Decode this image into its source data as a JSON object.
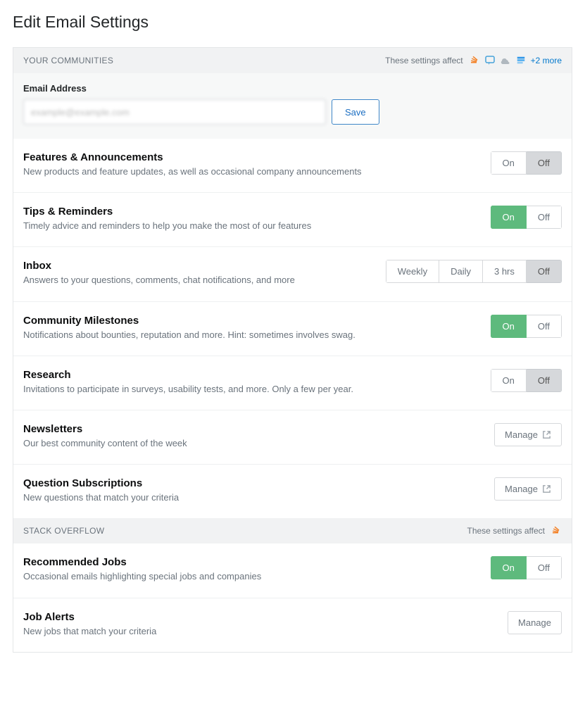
{
  "page_title": "Edit Email Settings",
  "affects_label": "These settings affect",
  "more_text": "+2 more",
  "on_label": "On",
  "off_label": "Off",
  "manage_label": "Manage",
  "email": {
    "label": "Email Address",
    "value": "example@example.com",
    "save": "Save"
  },
  "section1": {
    "header": "YOUR COMMUNITIES"
  },
  "section2": {
    "header": "STACK OVERFLOW"
  },
  "rows": {
    "features": {
      "title": "Features & Announcements",
      "desc": "New products and feature updates, as well as occasional company announcements"
    },
    "tips": {
      "title": "Tips & Reminders",
      "desc": "Timely advice and reminders to help you make the most of our features"
    },
    "inbox": {
      "title": "Inbox",
      "desc": "Answers to your questions, comments, chat notifications, and more",
      "options": {
        "weekly": "Weekly",
        "daily": "Daily",
        "hrs": "3 hrs"
      }
    },
    "milestones": {
      "title": "Community Milestones",
      "desc": "Notifications about bounties, reputation and more. Hint: sometimes involves swag."
    },
    "research": {
      "title": "Research",
      "desc": "Invitations to participate in surveys, usability tests, and more. Only a few per year."
    },
    "newsletters": {
      "title": "Newsletters",
      "desc": "Our best community content of the week"
    },
    "questions": {
      "title": "Question Subscriptions",
      "desc": "New questions that match your criteria"
    },
    "recjobs": {
      "title": "Recommended Jobs",
      "desc": "Occasional emails highlighting special jobs and companies"
    },
    "jobalerts": {
      "title": "Job Alerts",
      "desc": "New jobs that match your criteria"
    }
  }
}
